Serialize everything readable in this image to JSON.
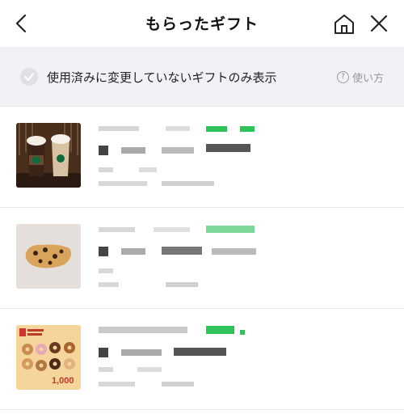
{
  "header": {
    "title": "もらったギフト",
    "back_icon": "chevron-left-icon",
    "home_icon": "home-icon",
    "close_icon": "close-icon"
  },
  "filter": {
    "label": "使用済みに変更していないギフトのみ表示",
    "checked": false,
    "help_label": "使い方",
    "help_icon": "question-circle-icon"
  },
  "gifts": [
    {
      "image": "starbucks-drinks",
      "redacted": true
    },
    {
      "image": "scone",
      "redacted": true
    },
    {
      "image": "mister-donut-1000-yen",
      "price_text": "1,000",
      "redacted": true
    }
  ],
  "colors": {
    "accent_green": "#2ec35a",
    "filter_bg": "#f1f2f5",
    "divider": "#e7e8ea"
  }
}
